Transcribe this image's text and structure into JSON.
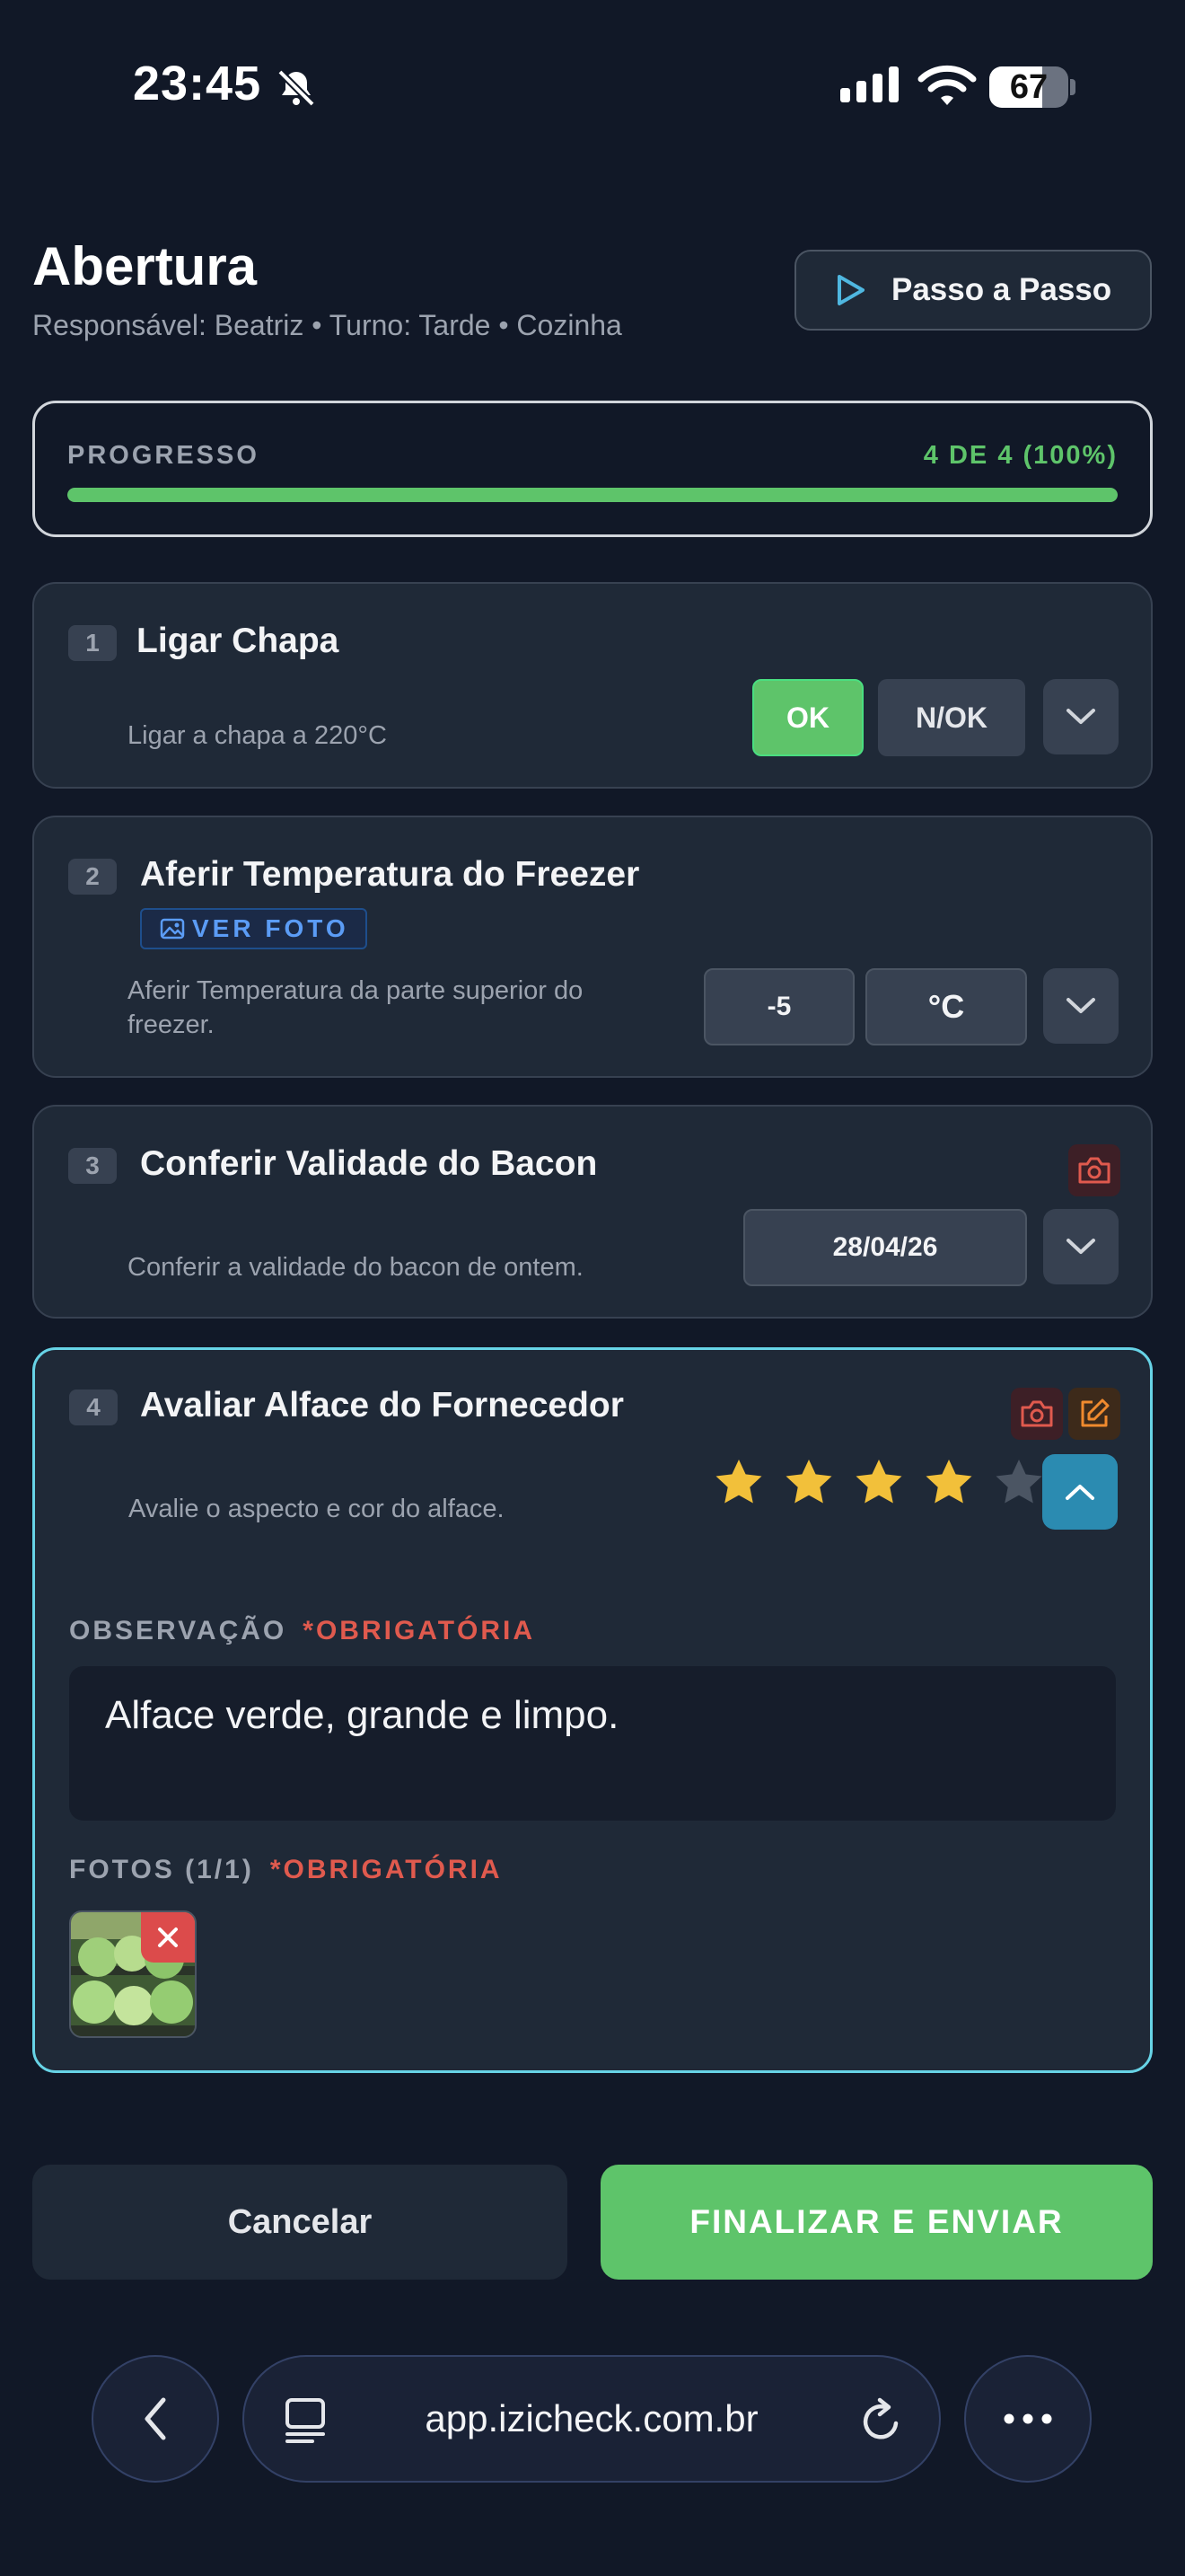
{
  "status_bar": {
    "time": "23:45",
    "battery": "67",
    "battery_level": 0.67
  },
  "header": {
    "title": "Abertura",
    "subtitle": "Responsável: Beatriz • Turno: Tarde • Cozinha",
    "walkthrough_button": "Passo a Passo"
  },
  "progress": {
    "label": "PROGRESSO",
    "value_text": "4 DE 4 (100%)",
    "fraction": 1.0,
    "color": "#5ec46a"
  },
  "items": [
    {
      "number": "1",
      "title": "Ligar Chapa",
      "description": "Ligar a chapa a 220°C",
      "ok_label": "OK",
      "nok_label": "N/OK",
      "selected": "OK"
    },
    {
      "number": "2",
      "title": "Aferir Temperatura do Freezer",
      "photo_link": "VER FOTO",
      "description_line1": "Aferir Temperatura da parte superior do",
      "description_line2": "freezer.",
      "value": "-5",
      "unit": "°C"
    },
    {
      "number": "3",
      "title": "Conferir Validade do Bacon",
      "description": "Conferir a validade do bacon de ontem.",
      "date": "28/04/26"
    },
    {
      "number": "4",
      "title": "Avaliar Alface do Fornecedor",
      "description": "Avalie o aspecto e cor do alface.",
      "rating": 4,
      "rating_max": 5,
      "observation_label": "OBSERVAÇÃO",
      "observation_required": "*OBRIGATÓRIA",
      "observation_text": "Alface verde, grande e limpo.",
      "photos_label": "FOTOS (1/1)",
      "photos_required": "*OBRIGATÓRIA"
    }
  ],
  "footer": {
    "cancel": "Cancelar",
    "submit": "FINALIZAR E ENVIAR"
  },
  "browser": {
    "url": "app.izicheck.com.br"
  },
  "colors": {
    "background": "#111827",
    "card": "#1f2937",
    "accent_green": "#5ec46a",
    "accent_cyan": "#67d3e6",
    "required_red": "#e05a4e",
    "star_gold": "#f2c03a"
  }
}
